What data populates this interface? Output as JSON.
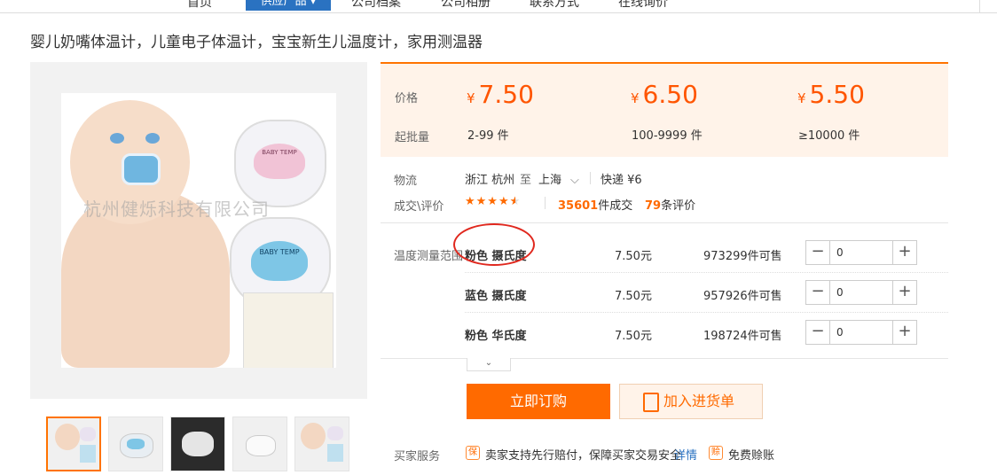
{
  "nav": {
    "items": [
      "首页",
      "供应产品 ▾",
      "公司档案",
      "公司相册",
      "联系方式",
      "在线询价"
    ]
  },
  "product": {
    "title": "婴儿奶嘴体温计，儿童电子体温计，宝宝新生儿温度计，家用测温器",
    "watermark": "杭州健烁科技有限公司",
    "device_label": "BABY TEMP"
  },
  "pricing": {
    "price_label": "价格",
    "moq_label": "起批量",
    "currency": "¥",
    "tiers": [
      {
        "price": "7.50",
        "moq": "2-99 件"
      },
      {
        "price": "6.50",
        "moq": "100-9999 件"
      },
      {
        "price": "5.50",
        "moq": "≥10000 件"
      }
    ]
  },
  "logistics": {
    "label": "物流",
    "from": "浙江 杭州",
    "to_word": "至",
    "to": "上海",
    "express": "快递 ¥6"
  },
  "deal": {
    "label": "成交\\评价",
    "rating": 4.5,
    "deals_num": "35601",
    "deals_suffix": "件成交",
    "reviews_num": "79",
    "reviews_suffix": "条评价"
  },
  "sku": {
    "label": "温度测量范围",
    "rows": [
      {
        "name": "粉色 摄氏度",
        "price": "7.50元",
        "stock": "973299件可售",
        "qty": "0"
      },
      {
        "name": "蓝色 摄氏度",
        "price": "7.50元",
        "stock": "957926件可售",
        "qty": "0"
      },
      {
        "name": "粉色 华氏度",
        "price": "7.50元",
        "stock": "198724件可售",
        "qty": "0"
      }
    ]
  },
  "actions": {
    "buy_now": "立即订购",
    "add_to_list": "加入进货单"
  },
  "services": {
    "label": "买家服务",
    "guarantee_icon": "保",
    "guarantee_text": "卖家支持先行赔付，保障买家交易安全",
    "details_link": "详情",
    "credit_icon": "赊",
    "credit_text": "免费赊账"
  },
  "colors": {
    "accent": "#ff6a00",
    "nav_active": "#2a72c1",
    "annotation": "#e0281e"
  }
}
